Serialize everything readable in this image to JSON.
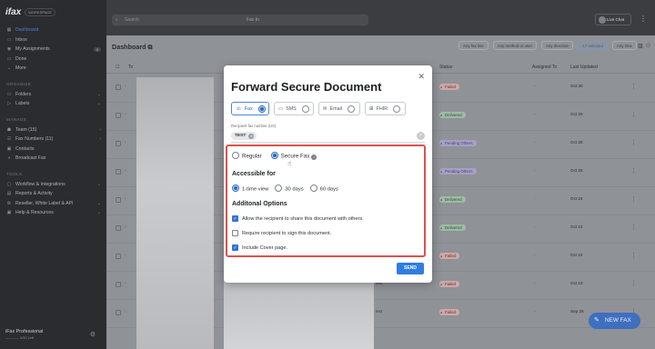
{
  "sidebar": {
    "logo": "ifax",
    "workspace": "WORKSPACE",
    "items": [
      {
        "label": "Dashboard",
        "icon": "grid-icon",
        "active": true
      },
      {
        "label": "Inbox",
        "icon": "inbox-icon"
      },
      {
        "label": "My Assignments",
        "icon": "person-icon",
        "badge": "0"
      },
      {
        "label": "Done",
        "icon": "check-icon"
      },
      {
        "label": "More",
        "icon": "chevron-down-icon"
      }
    ],
    "organize_label": "ORGANIZE",
    "organize_items": [
      {
        "label": "Folders",
        "badge": "0"
      },
      {
        "label": "Labels",
        "badge": "0"
      }
    ],
    "manage_label": "MANAGE",
    "manage_items": [
      {
        "label": "Team (15)"
      },
      {
        "label": "Fax Numbers (11)"
      },
      {
        "label": "Contacts"
      },
      {
        "label": "Broadcast Fax"
      }
    ],
    "tools_label": "TOOLS",
    "tools_items": [
      {
        "label": "Workflow & Integrations"
      },
      {
        "label": "Reports & Activity"
      },
      {
        "label": "Reseller, White Label & API"
      },
      {
        "label": "Help & Resources"
      }
    ],
    "plan": "iFax Professional",
    "plan_sub": "———— 9/20 Left"
  },
  "topbar": {
    "search_placeholder": "Search",
    "fax_in": "Fax In",
    "live_chat": "Live Chat"
  },
  "main": {
    "title": "Dashboard",
    "filters": [
      "Any fax line",
      "Any method or user",
      "Any direction",
      "17 selected",
      "Any time"
    ],
    "columns": {
      "to": "To",
      "status": "Status",
      "assigned": "Assigned To",
      "updated": "Last Updated"
    },
    "rows": [
      {
        "status": "Failed",
        "type": "failed",
        "assigned": "-",
        "updated": "Oct 30",
        "from": ""
      },
      {
        "status": "Delivered",
        "type": "delivered",
        "assigned": "-",
        "updated": "Oct 29",
        "from": ""
      },
      {
        "status": "Pending Others",
        "type": "pending",
        "assigned": "-",
        "updated": "Oct 28",
        "from": ""
      },
      {
        "status": "Pending Others",
        "type": "pending",
        "assigned": "-",
        "updated": "Oct 28",
        "from": ""
      },
      {
        "status": "Delivered",
        "type": "delivered",
        "assigned": "-",
        "updated": "Oct 24",
        "from": ""
      },
      {
        "status": "Delivered",
        "type": "delivered",
        "assigned": "-",
        "updated": "Oct 24",
        "from": ""
      },
      {
        "status": "Failed",
        "type": "failed",
        "assigned": "-",
        "updated": "Oct 24",
        "from": ""
      },
      {
        "status": "Failed",
        "type": "failed",
        "assigned": "-",
        "updated": "Oct 10",
        "from": "test"
      },
      {
        "status": "Failed",
        "type": "failed",
        "assigned": "-",
        "updated": "Sep 25",
        "from": "test"
      }
    ],
    "new_fax": "NEW FAX"
  },
  "modal": {
    "title": "Forward Secure Document",
    "channels": [
      {
        "label": "Fax",
        "selected": true
      },
      {
        "label": "SMS",
        "selected": false
      },
      {
        "label": "Email",
        "selected": false
      },
      {
        "label": "FHIR",
        "selected": false
      }
    ],
    "recipient_label": "Recipient fax number (US)",
    "recipient_chip": "TEST",
    "mode_regular": "Regular",
    "mode_secure": "Secure Fax",
    "accessible_label": "Accessible for",
    "access_options": [
      "1-time view",
      "30 days",
      "60 days"
    ],
    "additional_label": "Additonal Options",
    "opt_share": "Allow the recipient to share this document with others.",
    "opt_sign": "Require recipient to sign this document.",
    "opt_cover": "Include Cover page.",
    "send": "SEND"
  }
}
